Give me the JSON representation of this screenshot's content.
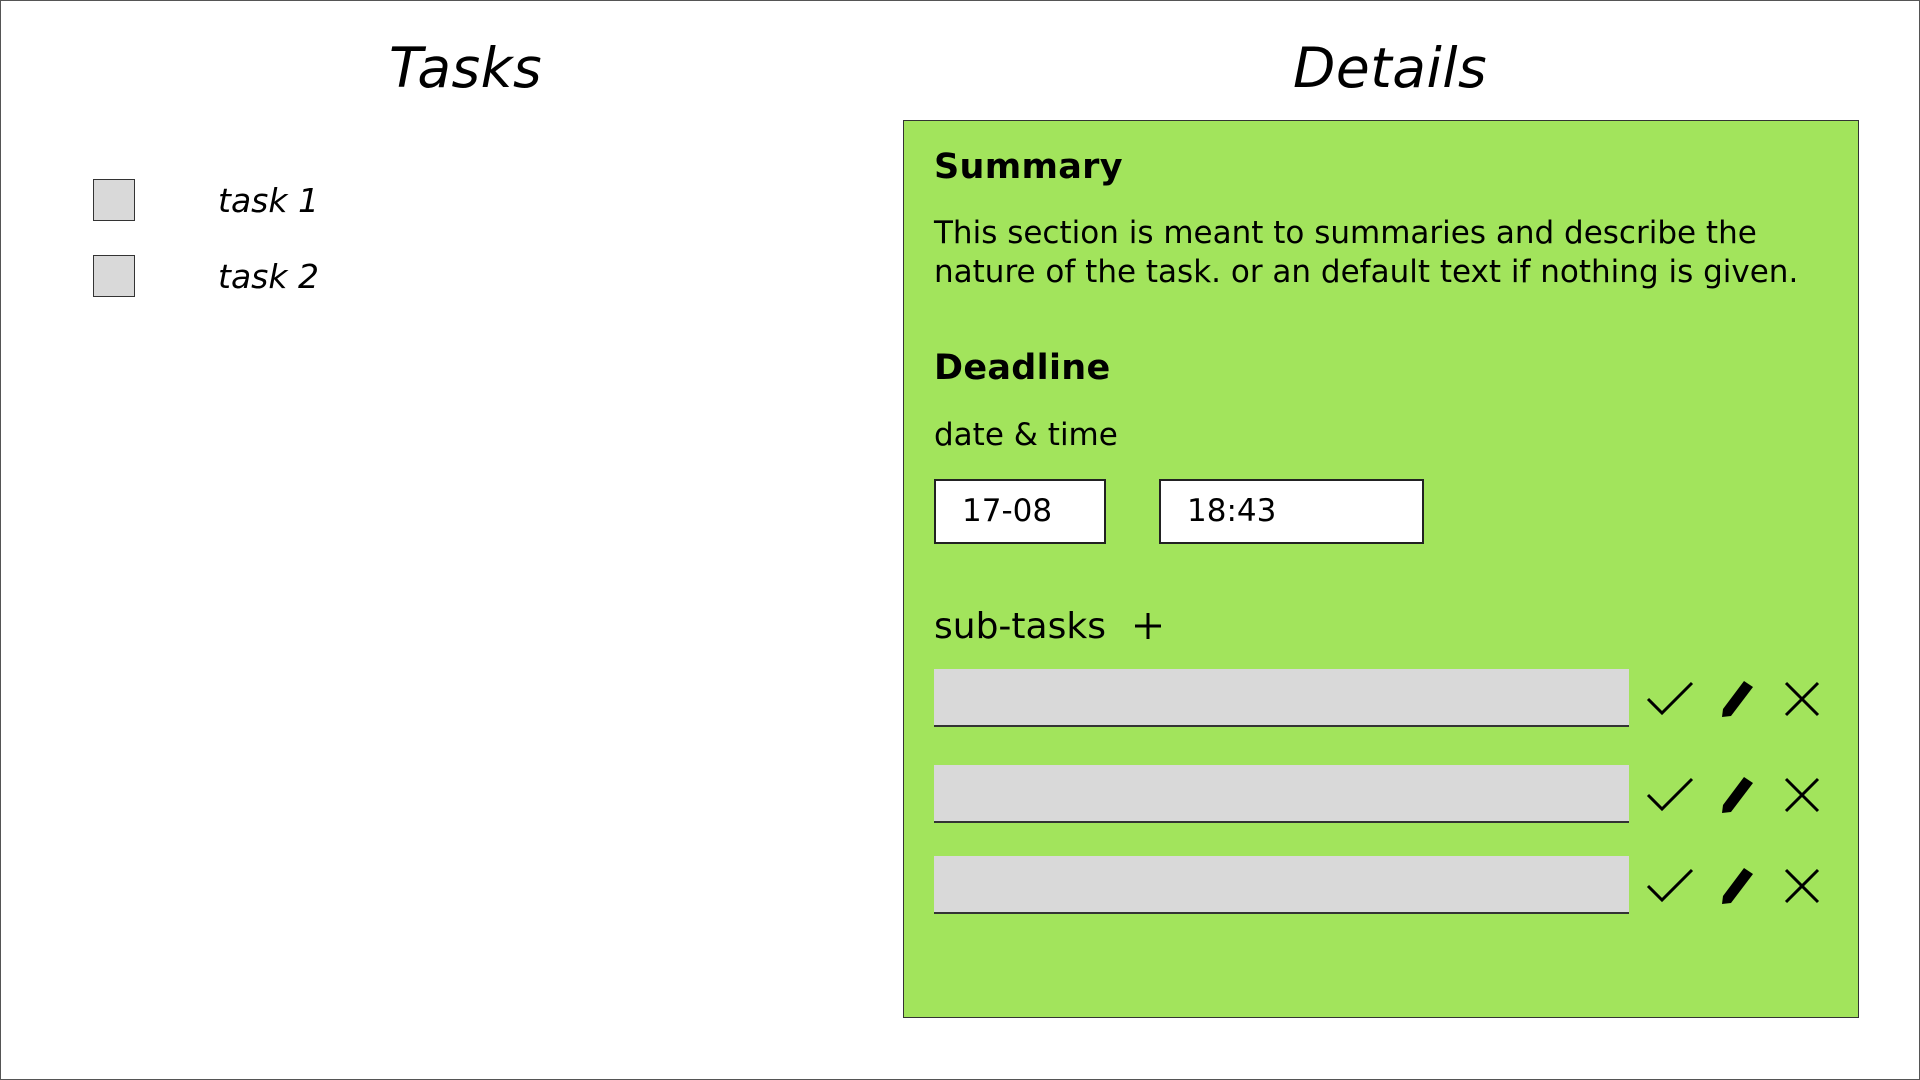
{
  "tasks_panel": {
    "heading": "Tasks",
    "items": [
      {
        "label": "task 1"
      },
      {
        "label": "task 2"
      }
    ]
  },
  "details_panel": {
    "heading": "Details",
    "background_color": "#a2e45c",
    "summary": {
      "title": "Summary",
      "text": "This section is meant to summaries and describe the nature of the task. or an default text if nothing is given."
    },
    "deadline": {
      "title": "Deadline",
      "label": "date & time",
      "date_value": "17-08",
      "time_value": "18:43"
    },
    "subtasks": {
      "label": "sub-tasks",
      "add_icon": "plus-icon",
      "rows": [
        {
          "value": "",
          "icons": [
            "check-icon",
            "pencil-icon",
            "close-icon"
          ]
        },
        {
          "value": "",
          "icons": [
            "check-icon",
            "pencil-icon",
            "close-icon"
          ]
        },
        {
          "value": "",
          "icons": [
            "check-icon",
            "pencil-icon",
            "close-icon"
          ]
        }
      ]
    }
  }
}
